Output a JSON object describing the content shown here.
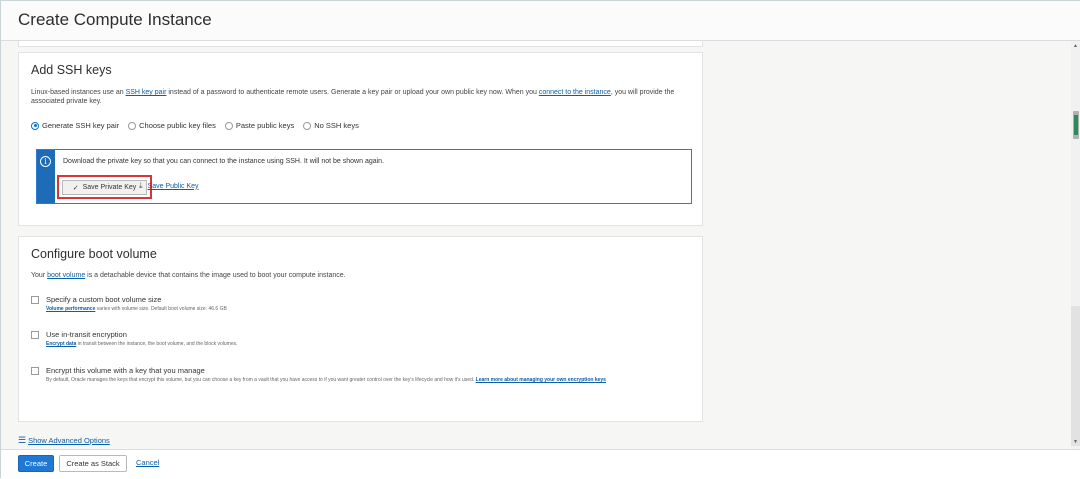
{
  "window": {
    "title": "Create Compute Instance"
  },
  "ssh": {
    "title": "Add SSH keys",
    "desc_prefix": "Linux-based instances use an ",
    "desc_link1": "SSH key pair",
    "desc_middle": " instead of a password to authenticate remote users. Generate a key pair or upload your own public key now. When you ",
    "desc_link2": "connect to the instance",
    "desc_suffix": ", you will provide the associated private key.",
    "options": [
      {
        "label": "Generate SSH key pair",
        "checked": true
      },
      {
        "label": "Choose public key files",
        "checked": false
      },
      {
        "label": "Paste public keys",
        "checked": false
      },
      {
        "label": "No SSH keys",
        "checked": false
      }
    ],
    "info_icon": "i",
    "info_text": "Download the private key so that you can connect to the instance using SSH. It will not be shown again.",
    "save_private_label": "Save Private Key",
    "save_private_icon": "✓",
    "save_public_label": "Save Public Key",
    "download_icon": "⤓"
  },
  "boot": {
    "title": "Configure boot volume",
    "desc_prefix": "Your ",
    "desc_link": "boot volume",
    "desc_suffix": " is a detachable device that contains the image used to boot your compute instance.",
    "options": [
      {
        "label": "Specify a custom boot volume size",
        "help_link": "Volume performance",
        "help_text": " varies with volume size. Default boot volume size: 46.6 GB",
        "help_link2": ""
      },
      {
        "label": "Use in-transit encryption",
        "help_link": "Encrypt data",
        "help_text": " in transit between the instance, the boot volume, and the block volumes.",
        "help_link2": ""
      },
      {
        "label": "Encrypt this volume with a key that you manage",
        "help_link": "",
        "help_text": "By default, Oracle manages the keys that encrypt this volume, but you can choose a key from a vault that you have access to if you want greater control over the key's lifecycle and how it's used. ",
        "help_link2": "Learn more about managing your own encryption keys"
      }
    ]
  },
  "advanced": {
    "icon": "☰",
    "label": "Show Advanced Options"
  },
  "footer": {
    "create": "Create",
    "stack": "Create as Stack",
    "cancel": "Cancel"
  },
  "scrollbar": {
    "up_icon": "▲",
    "down_icon": "▼"
  },
  "colors": {
    "primary": "#1f78d1",
    "link": "#0b5ea7",
    "highlight": "#d9343a",
    "info": "#1e6bb8"
  }
}
